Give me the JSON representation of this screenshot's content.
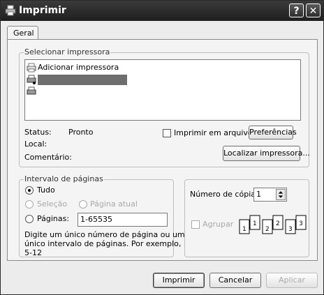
{
  "window": {
    "title": "Imprimir",
    "help_label": "?",
    "close_label": "✕"
  },
  "tabs": [
    {
      "label": "Geral"
    }
  ],
  "printer_section": {
    "label": "Selecionar impressora",
    "items": [
      {
        "label": "Adicionar impressora",
        "icon": "add-printer-icon"
      },
      {
        "label": "",
        "icon": "printer-icon",
        "selected": true
      },
      {
        "label": "",
        "icon": "printer-icon"
      }
    ],
    "status_label": "Status:",
    "status_value": "Pronto",
    "location_label": "Local:",
    "location_value": "",
    "comment_label": "Comentário:",
    "comment_value": "",
    "print_to_file_label": "Imprimir em arquivo",
    "preferences_button": "Preferências",
    "find_printer_button": "Localizar impressora..."
  },
  "page_range": {
    "label": "Intervalo de páginas",
    "all_label": "Tudo",
    "selection_label": "Seleção",
    "current_page_label": "Página atual",
    "pages_label": "Páginas:",
    "pages_value": "1-65535",
    "hint": [
      "Digite um único número de página ou um",
      "único intervalo de páginas. Por exemplo,",
      "5-12"
    ],
    "selected": "all"
  },
  "copies": {
    "label": "Número de cópias:",
    "value": "1",
    "collate_label": "Agrupar",
    "collate_checked": false,
    "collate_digits": [
      "1",
      "1",
      "2",
      "2",
      "3",
      "3"
    ]
  },
  "footer": {
    "print_button": "Imprimir",
    "cancel_button": "Cancelar",
    "apply_button": "Aplicar"
  },
  "colors": {
    "titlebar": "#2b2b2b",
    "selection": "#6e6e6e",
    "dialog_bg": "#ececec"
  }
}
